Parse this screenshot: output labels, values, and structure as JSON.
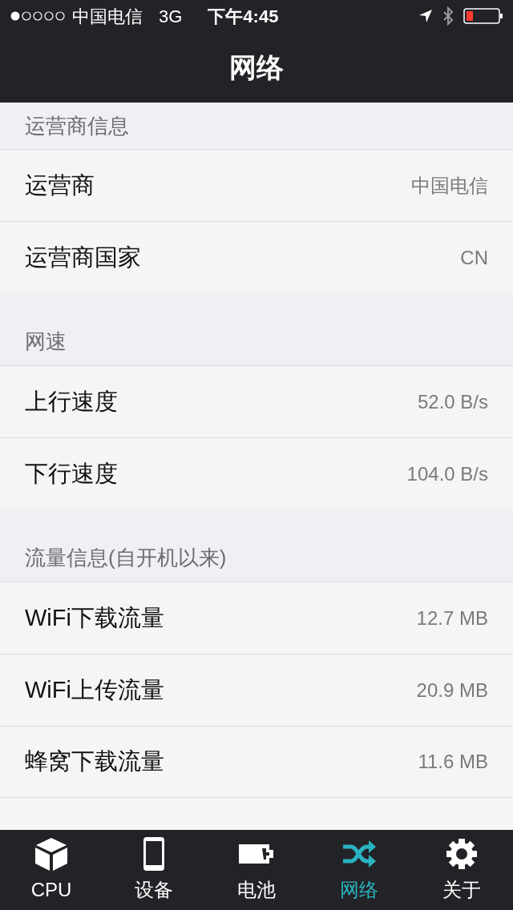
{
  "status_bar": {
    "carrier": "中国电信",
    "network": "3G",
    "time": "下午4:45"
  },
  "nav_bar": {
    "title": "网络"
  },
  "sections": [
    {
      "header": "运营商信息",
      "rows": [
        {
          "label": "运营商",
          "value": "中国电信"
        },
        {
          "label": "运营商国家",
          "value": "CN"
        }
      ]
    },
    {
      "header": "网速",
      "rows": [
        {
          "label": "上行速度",
          "value": "52.0 B/s"
        },
        {
          "label": "下行速度",
          "value": "104.0 B/s"
        }
      ]
    },
    {
      "header": "流量信息(自开机以来)",
      "rows": [
        {
          "label": "WiFi下载流量",
          "value": "12.7 MB"
        },
        {
          "label": "WiFi上传流量",
          "value": "20.9 MB"
        },
        {
          "label": "蜂窝下载流量",
          "value": "11.6 MB"
        }
      ]
    }
  ],
  "tab_bar": [
    {
      "label": "CPU",
      "kind": "cube",
      "selected": false
    },
    {
      "label": "设备",
      "kind": "phone",
      "selected": false
    },
    {
      "label": "电池",
      "kind": "battery",
      "selected": false
    },
    {
      "label": "网络",
      "kind": "shuffle",
      "selected": true
    },
    {
      "label": "关于",
      "kind": "gear",
      "selected": false
    }
  ]
}
